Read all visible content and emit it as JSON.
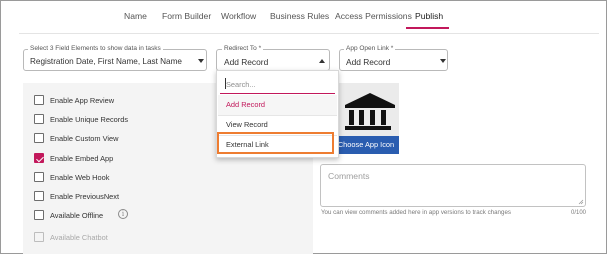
{
  "tabs": [
    {
      "label": "Name"
    },
    {
      "label": "Form Builder"
    },
    {
      "label": "Workflow"
    },
    {
      "label": "Business Rules"
    },
    {
      "label": "Access Permissions"
    },
    {
      "label": "Publish"
    }
  ],
  "active_tab": "Publish",
  "field_elements": {
    "label": "Select 3 Field Elements to show data in tasks",
    "value": "Registration Date, First Name, Last Name"
  },
  "redirect_to": {
    "label": "Redirect To *",
    "value": "Add Record",
    "open": true
  },
  "app_open_link": {
    "label": "App Open Link *",
    "value": "Add Record"
  },
  "dropdown": {
    "search_placeholder": "Search...",
    "options": [
      {
        "label": "Add Record",
        "selected": true
      },
      {
        "label": "View Record",
        "selected": false
      },
      {
        "label": "External Link",
        "selected": false,
        "highlighted": true
      }
    ]
  },
  "options": [
    {
      "label": "Enable App Review",
      "checked": false,
      "disabled": false
    },
    {
      "label": "Enable Unique Records",
      "checked": false,
      "disabled": false
    },
    {
      "label": "Enable Custom View",
      "checked": false,
      "disabled": false
    },
    {
      "label": "Enable Embed App",
      "checked": true,
      "disabled": false
    },
    {
      "label": "Enable Web Hook",
      "checked": false,
      "disabled": false
    },
    {
      "label": "Enable PreviousNext",
      "checked": false,
      "disabled": false
    },
    {
      "label": "Available Offline",
      "checked": false,
      "disabled": false,
      "info_icon": "info-icon"
    },
    {
      "label": "Available Chatbot",
      "checked": false,
      "disabled": true
    }
  ],
  "app_icon": {
    "icon": "bank-building-icon",
    "button_label": "Choose App Icon"
  },
  "comments": {
    "placeholder": "Comments",
    "help_text": "You can view comments added here in app versions to track changes",
    "counter": "0/100"
  },
  "colors": {
    "accent": "#c2185b",
    "button_blue": "#2a5db0",
    "highlight": "#ee7d31"
  }
}
